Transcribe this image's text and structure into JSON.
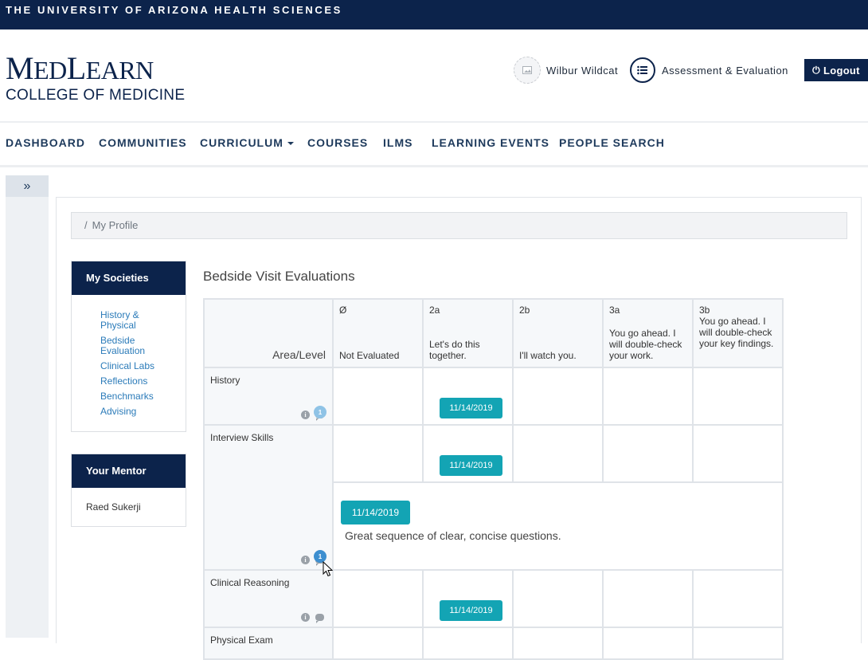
{
  "header": {
    "university": "THE UNIVERSITY OF ARIZONA HEALTH SCIENCES",
    "logo_main_med": "M",
    "logo_main_rest1": "ED",
    "logo_main_l": "L",
    "logo_main_rest2": "EARN",
    "logo_sub": "COLLEGE OF MEDICINE",
    "user_name": "Wilbur Wildcat",
    "assessment_label": "Assessment & Evaluation",
    "logout_label": "Logout"
  },
  "nav": {
    "items": [
      "DASHBOARD",
      "COMMUNITIES",
      "CURRICULUM",
      "COURSES",
      "ILMS",
      "LEARNING EVENTS",
      "PEOPLE SEARCH"
    ]
  },
  "sidebar": {
    "toggle_icon": "»"
  },
  "breadcrumb": {
    "separator": "/",
    "current": "My Profile"
  },
  "societies": {
    "title": "My Societies",
    "links": [
      "History & Physical",
      "Bedside Evaluation",
      "Clinical Labs",
      "Reflections",
      "Benchmarks",
      "Advising"
    ]
  },
  "mentor": {
    "title": "Your Mentor",
    "name": "Raed Sukerji"
  },
  "evaluations": {
    "title": "Bedside Visit Evaluations",
    "corner_label": "Area/Level",
    "levels": [
      {
        "code": "Ø",
        "desc": "Not Evaluated"
      },
      {
        "code": "2a",
        "desc": "Let's do this together."
      },
      {
        "code": "2b",
        "desc": "I'll watch you."
      },
      {
        "code": "3a",
        "desc": "You go ahead. I will double-check your work."
      },
      {
        "code": "3b",
        "desc": "You go ahead. I will double-check your key findings."
      }
    ],
    "rows": [
      {
        "area": "History",
        "chip": "11/14/2019",
        "badge": "1"
      },
      {
        "area": "Interview Skills",
        "chip": "11/14/2019",
        "badge": "1",
        "comment_date": "11/14/2019",
        "comment_text": "Great sequence of clear, concise questions."
      },
      {
        "area": "Clinical Reasoning",
        "chip": "11/14/2019"
      },
      {
        "area": "Physical Exam"
      }
    ]
  },
  "colors": {
    "navy": "#0c234b",
    "teal": "#13a4b4",
    "link": "#2b7bb9"
  }
}
